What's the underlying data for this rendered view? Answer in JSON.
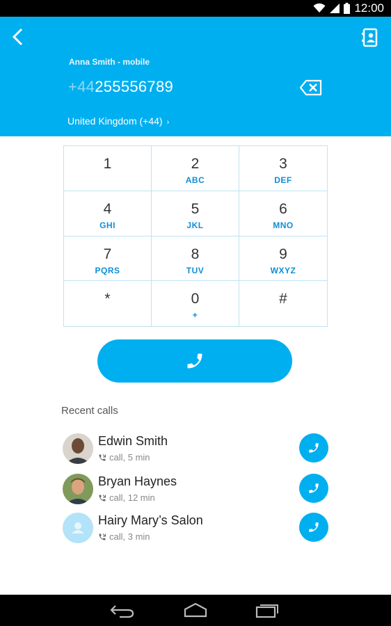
{
  "status": {
    "time": "12:00"
  },
  "header": {
    "caller": "Anna Smith - mobile",
    "number_prefix": "+44",
    "number_rest": "255556789",
    "country": "United Kingdom (+44)"
  },
  "keypad": [
    {
      "digit": "1",
      "letters": ""
    },
    {
      "digit": "2",
      "letters": "ABC"
    },
    {
      "digit": "3",
      "letters": "DEF"
    },
    {
      "digit": "4",
      "letters": "GHI"
    },
    {
      "digit": "5",
      "letters": "JKL"
    },
    {
      "digit": "6",
      "letters": "MNO"
    },
    {
      "digit": "7",
      "letters": "PQRS"
    },
    {
      "digit": "8",
      "letters": "TUV"
    },
    {
      "digit": "9",
      "letters": "WXYZ"
    },
    {
      "digit": "*",
      "letters": ""
    },
    {
      "digit": "0",
      "letters": "+"
    },
    {
      "digit": "#",
      "letters": ""
    }
  ],
  "recent": {
    "title": "Recent calls",
    "items": [
      {
        "name": "Edwin Smith",
        "detail": "call, 5 min"
      },
      {
        "name": "Bryan Haynes",
        "detail": "call, 12 min"
      },
      {
        "name": "Hairy Mary’s Salon",
        "detail": "call, 3 min"
      }
    ]
  },
  "colors": {
    "accent": "#00aff0",
    "link": "#0d8fd6"
  }
}
